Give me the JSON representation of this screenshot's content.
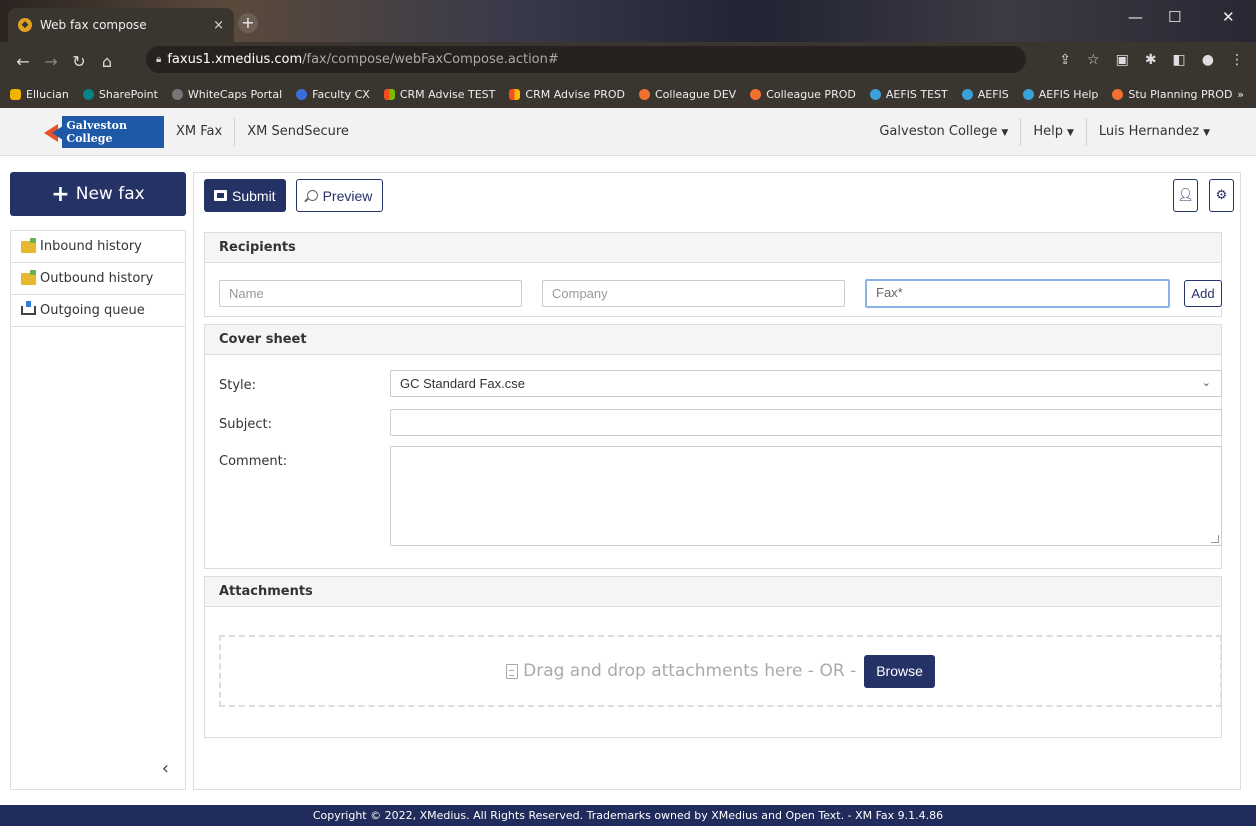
{
  "browser": {
    "tab_title": "Web fax compose",
    "tab_close": "×",
    "new_tab": "+",
    "url_host": "faxus1.xmedius.com",
    "url_path": "/fax/compose/webFaxCompose.action#",
    "bookmarks": [
      {
        "label": "Ellucian",
        "color": "#f0b400"
      },
      {
        "label": "SharePoint",
        "color": "#038387"
      },
      {
        "label": "WhiteCaps Portal",
        "color": "#777777"
      },
      {
        "label": "Faculty CX",
        "color": "#3b6fd8"
      },
      {
        "label": "CRM Advise TEST",
        "color": "#f25022"
      },
      {
        "label": "CRM Advise PROD",
        "color": "#f25022"
      },
      {
        "label": "Colleague DEV",
        "color": "#f07030"
      },
      {
        "label": "Colleague PROD",
        "color": "#f07030"
      },
      {
        "label": "AEFIS TEST",
        "color": "#3aa0d8"
      },
      {
        "label": "AEFIS",
        "color": "#3aa0d8"
      },
      {
        "label": "AEFIS Help",
        "color": "#3aa0d8"
      },
      {
        "label": "Stu Planning PROD",
        "color": "#f07030"
      }
    ]
  },
  "header": {
    "logo_text": "Galveston College",
    "nav": [
      "XM Fax",
      "XM SendSecure"
    ],
    "right": [
      "Galveston College",
      "Help",
      "Luis Hernandez"
    ]
  },
  "sidebar": {
    "new_fax": "New fax",
    "items": [
      "Inbound history",
      "Outbound history",
      "Outgoing queue"
    ]
  },
  "toolbar": {
    "submit": "Submit",
    "preview": "Preview"
  },
  "recipients": {
    "title": "Recipients",
    "name_placeholder": "Name",
    "company_placeholder": "Company",
    "fax_placeholder": "Fax*",
    "add": "Add"
  },
  "cover": {
    "title": "Cover sheet",
    "style_label": "Style:",
    "style_value": "GC Standard Fax.cse",
    "subject_label": "Subject:",
    "comment_label": "Comment:"
  },
  "attachments": {
    "title": "Attachments",
    "drop_text": "Drag and drop attachments here - OR -",
    "browse": "Browse"
  },
  "footer": "Copyright © 2022, XMedius. All Rights Reserved. Trademarks owned by XMedius and Open Text. - XM Fax 9.1.4.86"
}
